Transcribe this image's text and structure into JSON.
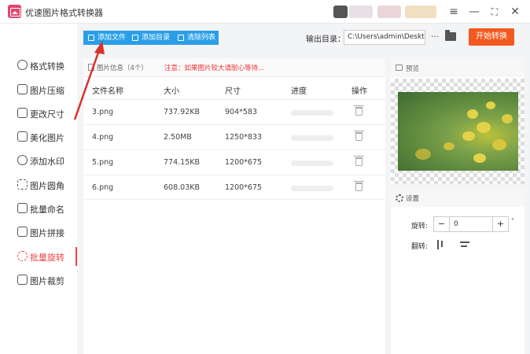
{
  "app": {
    "title": "优速图片格式转换器",
    "window_controls": {
      "menu": "≡",
      "minimize": "—",
      "maximize": "⛶",
      "close": "✕"
    }
  },
  "sidebar": {
    "items": [
      {
        "label": "格式转换",
        "icon": "format-convert-icon",
        "active": false
      },
      {
        "label": "图片压缩",
        "icon": "compress-icon",
        "active": false
      },
      {
        "label": "更改尺寸",
        "icon": "resize-icon",
        "active": false
      },
      {
        "label": "美化图片",
        "icon": "beautify-icon",
        "active": false
      },
      {
        "label": "添加水印",
        "icon": "watermark-icon",
        "active": false
      },
      {
        "label": "图片圆角",
        "icon": "rounded-corner-icon",
        "active": false
      },
      {
        "label": "批量命名",
        "icon": "rename-icon",
        "active": false
      },
      {
        "label": "图片拼接",
        "icon": "stitch-icon",
        "active": false
      },
      {
        "label": "批量旋转",
        "icon": "rotate-icon",
        "active": true
      },
      {
        "label": "图片裁剪",
        "icon": "crop-icon",
        "active": false
      }
    ],
    "active_color": "#ee4444"
  },
  "toolbar": {
    "add_file": "添加文件",
    "add_folder": "添加目录",
    "clear_list": "清除列表",
    "output_label": "输出目录：",
    "output_path": "C:\\Users\\admin\\Deskto",
    "more": "···",
    "start": "开始转换",
    "accent_color": "#2a9fe8",
    "start_color": "#f25a1f"
  },
  "file_panel": {
    "info_label": "图片信息（4个）",
    "warning": "注意：如果图片较大请耐心等待...",
    "columns": [
      "文件名称",
      "大小",
      "尺寸",
      "进度",
      "操作"
    ],
    "rows": [
      {
        "name": "3.png",
        "size": "737.92KB",
        "dimensions": "904*583",
        "progress": 0
      },
      {
        "name": "4.png",
        "size": "2.50MB",
        "dimensions": "1250*833",
        "progress": 0
      },
      {
        "name": "5.png",
        "size": "774.15KB",
        "dimensions": "1200*675",
        "progress": 0
      },
      {
        "name": "6.png",
        "size": "608.03KB",
        "dimensions": "1200*675",
        "progress": 0
      }
    ]
  },
  "preview": {
    "label": "预览"
  },
  "settings": {
    "label": "设置",
    "rotate_label": "旋转:",
    "rotate_value": "0",
    "degree_mark": "°",
    "flip_label": "翻转:",
    "minus": "−",
    "plus": "+"
  },
  "annotation": {
    "arrow_color": "#d9322a"
  }
}
